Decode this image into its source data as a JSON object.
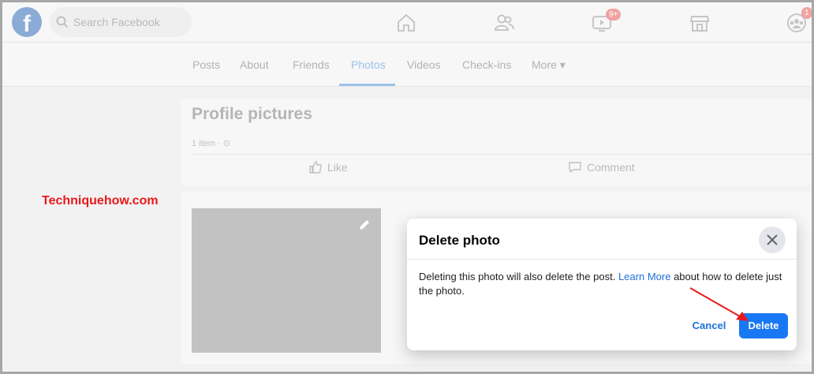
{
  "topbar": {
    "logo_letter": "f",
    "search_placeholder": "Search Facebook",
    "watch_badge": "9+",
    "profile_badge": "1"
  },
  "profile_tabs": [
    "Posts",
    "About",
    "Friends",
    "Photos",
    "Videos",
    "Check-ins",
    "More ▾"
  ],
  "active_tab": "Photos",
  "album": {
    "title": "Profile pictures",
    "meta": "1 item · ⊙",
    "like_label": "Like",
    "comment_label": "Comment"
  },
  "watermark": "Techniquehow.com",
  "dialog": {
    "title": "Delete photo",
    "body_before": "Deleting this photo will also delete the post.",
    "link_text": "Learn More",
    "body_after": "about how to delete just the photo.",
    "cancel_label": "Cancel",
    "delete_label": "Delete"
  },
  "colors": {
    "accent": "#1877f2",
    "link": "#216fdb",
    "watermark": "#e8191c",
    "annotation_arrow": "#e8191c"
  },
  "icons": [
    "facebook-logo-icon",
    "search-icon",
    "home-icon",
    "friends-icon",
    "watch-icon",
    "marketplace-icon",
    "groups-icon",
    "like-icon",
    "comment-icon",
    "pencil-icon",
    "close-icon",
    "arrow-annotation"
  ]
}
